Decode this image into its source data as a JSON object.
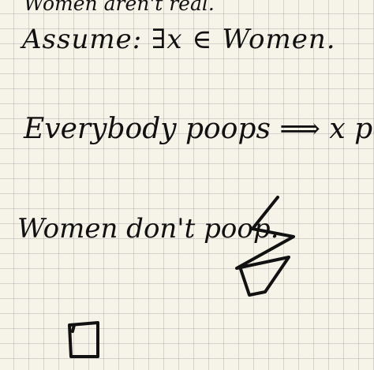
{
  "lines": [
    "Women aren't real.",
    "Assume: ∃x ∈ Women.",
    "Everybody poops ⟹ x poops.",
    "Women don't poop."
  ],
  "symbols": [
    "lightning-contradiction-icon",
    "qed-box-icon"
  ]
}
